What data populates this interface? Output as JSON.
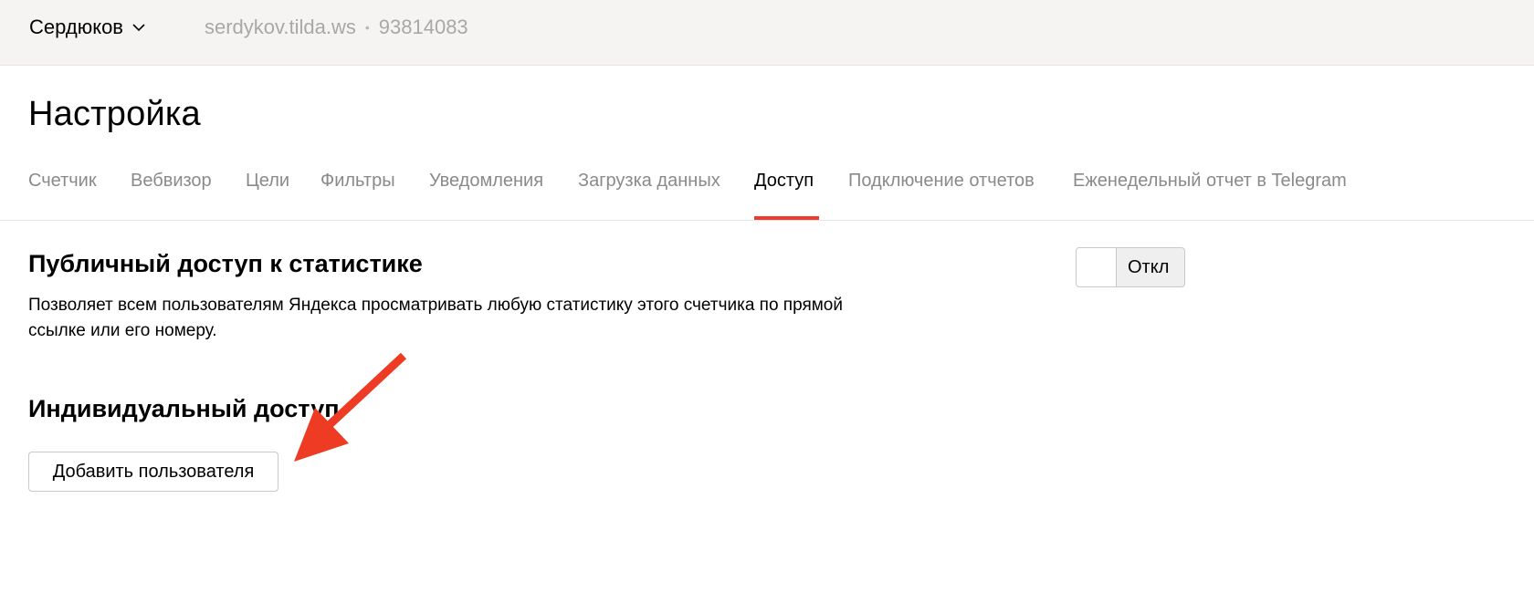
{
  "topbar": {
    "counter_name": "Сердюков",
    "site": "serdykov.tilda.ws",
    "separator": "•",
    "counter_id": "93814083"
  },
  "page": {
    "title": "Настройка"
  },
  "tabs": [
    {
      "label": "Счетчик",
      "active": false
    },
    {
      "label": "Вебвизор",
      "active": false
    },
    {
      "label": "Цели",
      "active": false
    },
    {
      "label": "Фильтры",
      "active": false
    },
    {
      "label": "Уведомления",
      "active": false
    },
    {
      "label": "Загрузка данных",
      "active": false
    },
    {
      "label": "Доступ",
      "active": true
    },
    {
      "label": "Подключение отчетов",
      "active": false
    },
    {
      "label": "Еженедельный отчет в Telegram",
      "active": false
    }
  ],
  "public_access": {
    "title": "Публичный доступ к статистике",
    "description": "Позволяет всем пользователям Яндекса просматривать любую статистику этого счетчика по прямой ссылке или его номеру.",
    "toggle_label": "Откл",
    "enabled": false
  },
  "individual_access": {
    "title": "Индивидуальный доступ",
    "add_button_label": "Добавить пользователя"
  },
  "colors": {
    "accent": "#f03b2a",
    "annotation_arrow": "#ee3b24"
  },
  "icons": {
    "dropdown": "chevron-down-icon",
    "annotation": "arrow-annotation-icon"
  }
}
